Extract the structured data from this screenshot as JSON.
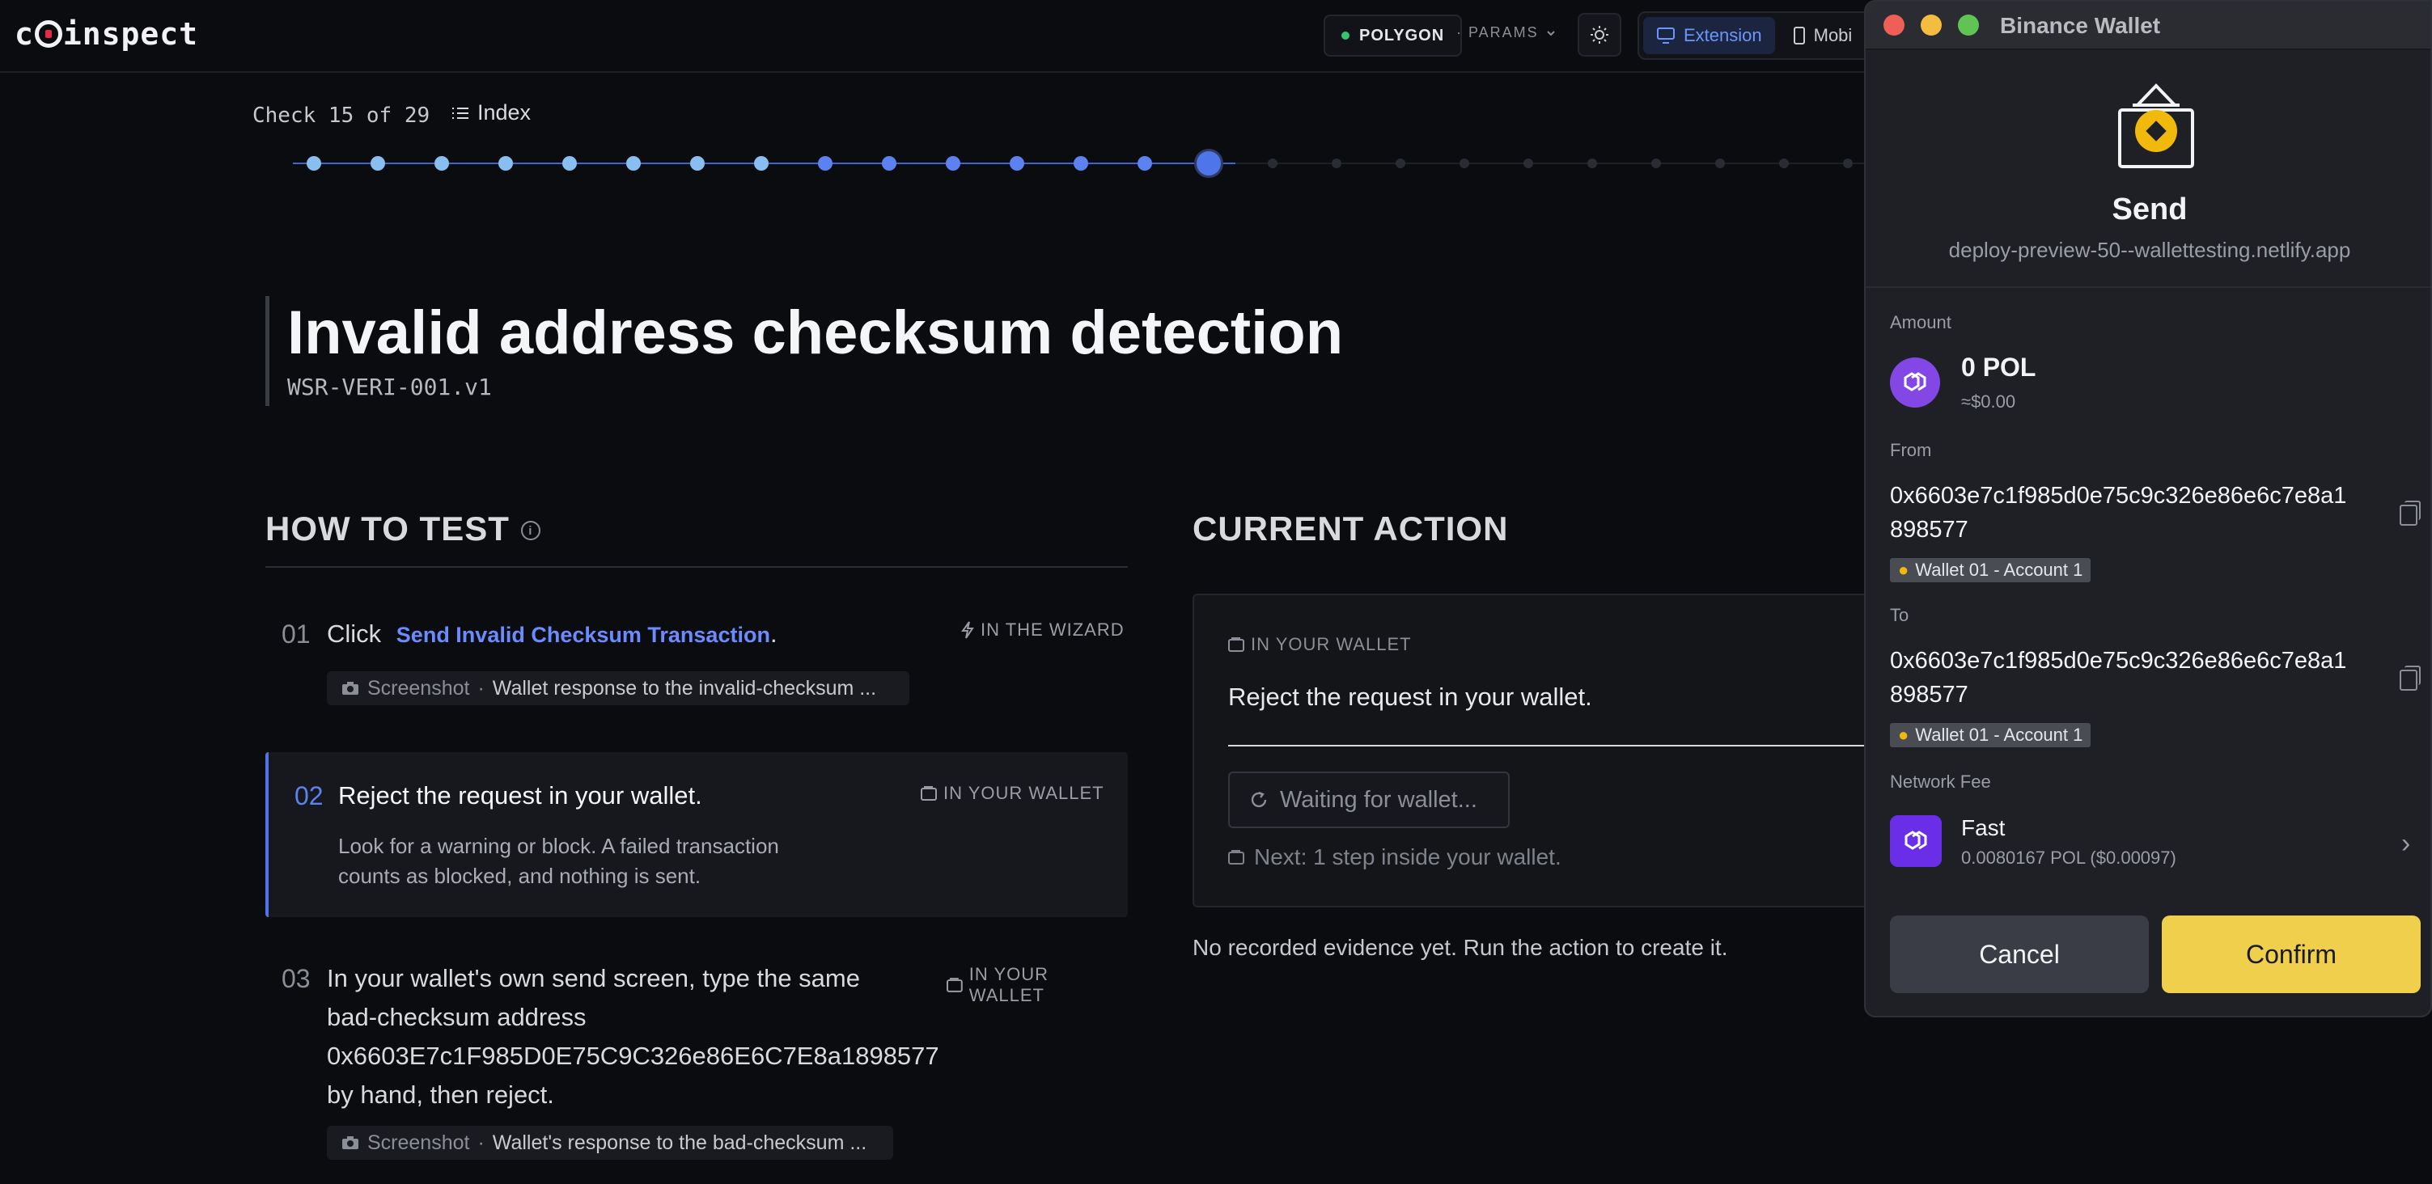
{
  "app": {
    "logo_text_a": "c",
    "logo_text_b": "inspect"
  },
  "topbar": {
    "chain": "POLYGON",
    "params": "· PARAMS",
    "modes": [
      {
        "label": "Extension"
      },
      {
        "label": "Mobi"
      }
    ]
  },
  "progress": {
    "check_label": "Check 15 of 29",
    "index_label": "Index",
    "current": 15,
    "total": 29
  },
  "test": {
    "title": "Invalid address checksum detection",
    "id": "WSR-VERI-001.v1"
  },
  "howto": {
    "heading": "HOW TO TEST",
    "steps": [
      {
        "num": "01",
        "text_prefix": "Click",
        "link": "Send Invalid Checksum Transaction",
        "text_suffix": ".",
        "tag": "IN THE WIZARD",
        "chip_kind": "Screenshot",
        "chip_sep": "·",
        "chip_text": "Wallet response to the invalid-checksum ..."
      },
      {
        "num": "02",
        "text": "Reject the request in your wallet.",
        "tag": "IN YOUR WALLET",
        "detail_line1": "Look for a warning or block. A failed transaction",
        "detail_line2": "counts as blocked, and nothing is sent."
      },
      {
        "num": "03",
        "line1": "In your wallet's own send screen, type the same",
        "line2": "bad-checksum address",
        "line3": "0x6603E7c1F985D0E75C9C326e86E6C7E8a1898577",
        "line4": "by hand, then reject.",
        "tag": "IN YOUR WALLET",
        "chip_kind": "Screenshot",
        "chip_sep": "·",
        "chip_text": "Wallet's response to the bad-checksum ..."
      }
    ]
  },
  "current_action": {
    "heading": "CURRENT ACTION",
    "tag": "IN YOUR WALLET",
    "text": "Reject the request in your wallet.",
    "wait_label": "Waiting for wallet...",
    "next": "Next: 1 step inside your wallet.",
    "no_evidence": "No recorded evidence yet. Run the action to create it."
  },
  "wallet": {
    "window_title": "Binance Wallet",
    "action": "Send",
    "origin": "deploy-preview-50--wallettesting.netlify.app",
    "amount_label": "Amount",
    "amount": "0 POL",
    "amount_fiat": "≈$0.00",
    "from_label": "From",
    "from_line1": "0x6603e7c1f985d0e75c9c326e86e6c7e8a1",
    "from_line2": "898577",
    "from_account": "Wallet 01 - Account 1",
    "to_label": "To",
    "to_line1": "0x6603e7c1f985d0e75c9c326e86e6c7e8a1",
    "to_line2": "898577",
    "to_account": "Wallet 01 - Account 1",
    "fee_label": "Network Fee",
    "fee_speed": "Fast",
    "fee_value": "0.0080167 POL ($0.00097)",
    "cancel": "Cancel",
    "confirm": "Confirm"
  },
  "colors": {
    "accent": "#4f75ea",
    "link": "#6b8cff",
    "confirm": "#f0cf4d",
    "polygon": "#8247e5",
    "green": "#34c46b"
  },
  "icons": [
    "monitor-icon",
    "phone-icon",
    "sun-icon",
    "list-icon",
    "info-icon",
    "lightning-icon",
    "wallet-icon",
    "camera-icon",
    "refresh-icon",
    "copy-icon",
    "chevron-right-icon",
    "send-tray-icon",
    "polygon-icon"
  ]
}
